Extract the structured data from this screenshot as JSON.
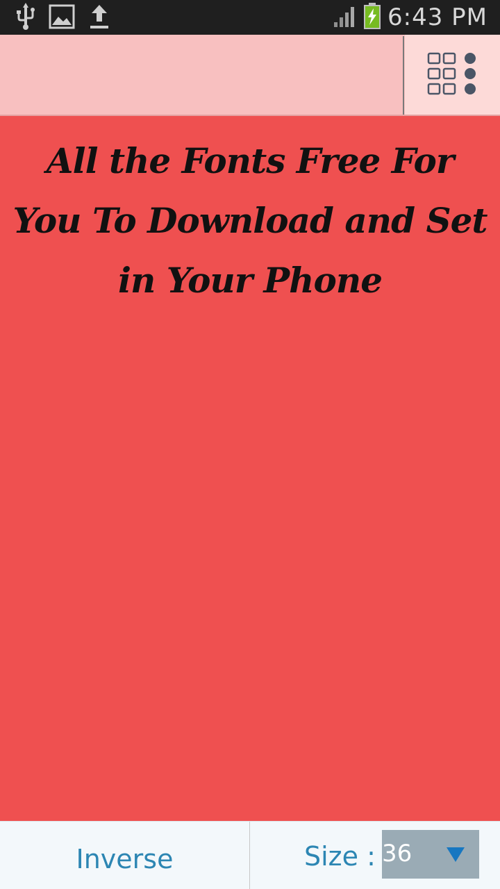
{
  "status_bar": {
    "time": "6:43 PM",
    "left_icons": [
      "usb-icon",
      "image-icon",
      "upload-icon"
    ],
    "right_icons": [
      "signal-icon",
      "battery-charging-icon"
    ]
  },
  "top_bar": {
    "menu_icon": "grid-menu-icon"
  },
  "preview": {
    "text": "All the Fonts Free For You To Download and Set in Your Phone"
  },
  "bottom_bar": {
    "inverse_label": "Inverse",
    "size_label": "Size :",
    "size_value": "36",
    "dropdown_icon": "triangle-down-icon"
  },
  "colors": {
    "status_bar": "#1f1f1f",
    "top_bar": "#f8c0c0",
    "menu_button_bg": "#fddad8",
    "content_bg": "#ef5050",
    "bottom_bar": "#f3f8fb",
    "accent_text": "#2c86b3",
    "select_bg": "#9aabb5",
    "arrow": "#1777c1"
  }
}
